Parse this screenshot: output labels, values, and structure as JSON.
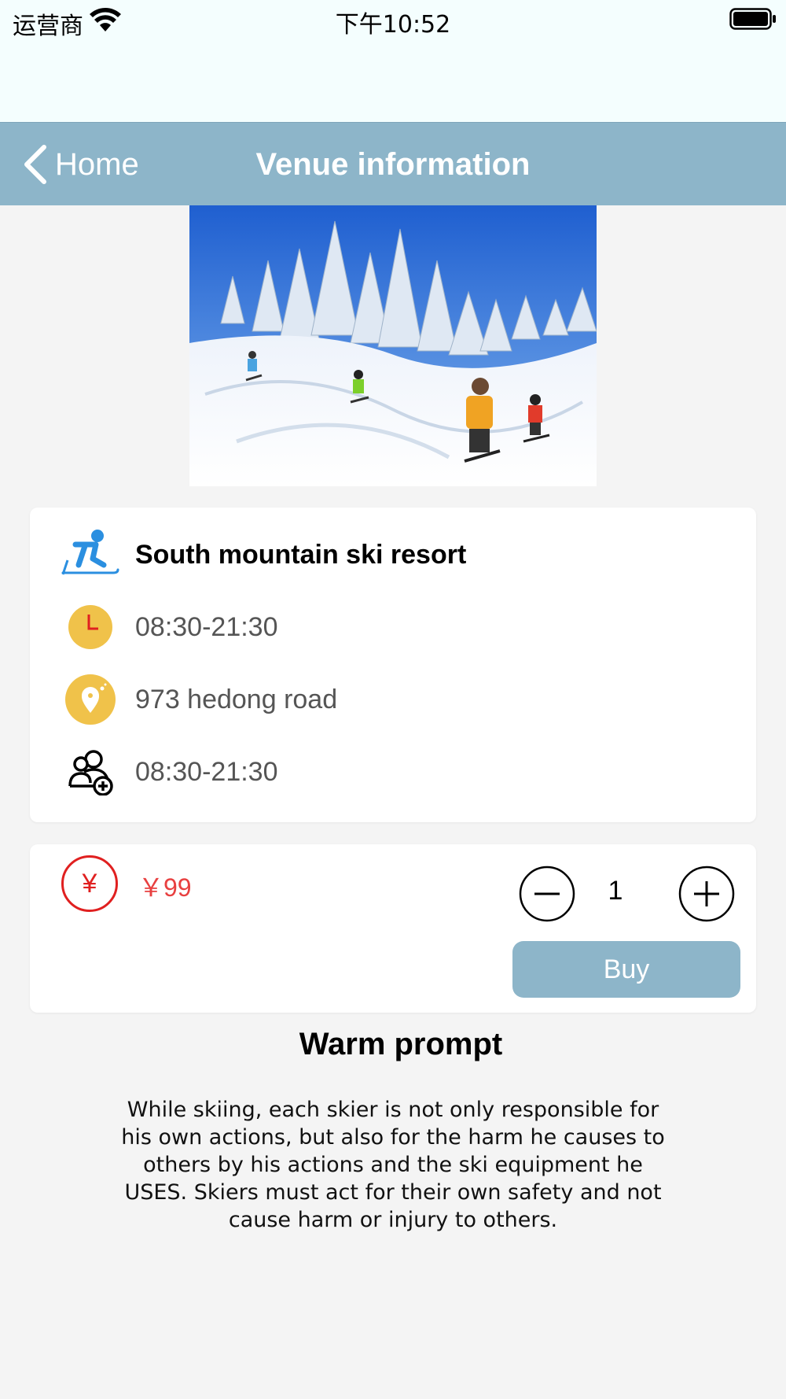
{
  "status_bar": {
    "carrier": "运营商",
    "time": "下午10:52",
    "wifi_icon": "wifi-icon",
    "battery_icon": "battery-icon"
  },
  "navbar": {
    "back_label": "Home",
    "title": "Venue information",
    "background": "#8db5c9"
  },
  "hero_image": {
    "subject": "skiers-on-snowy-slope-image"
  },
  "venue": {
    "name": "South mountain ski resort",
    "hours": "08:30-21:30",
    "address": "973 hedong road",
    "capacity_hours": "08:30-21:30",
    "icons": [
      "skier-icon",
      "clock-icon",
      "location-pin-icon",
      "add-user-icon"
    ]
  },
  "purchase": {
    "currency_symbol": "¥",
    "price": "￥99",
    "quantity": "1",
    "buy_label": "Buy",
    "accent": "#e02020"
  },
  "prompt": {
    "title": "Warm prompt",
    "body": "While skiing, each skier is not only responsible for his own actions, but also for the harm he causes to others by his actions and the ski equipment he USES. Skiers must act for their own safety and not cause harm or injury to others."
  }
}
